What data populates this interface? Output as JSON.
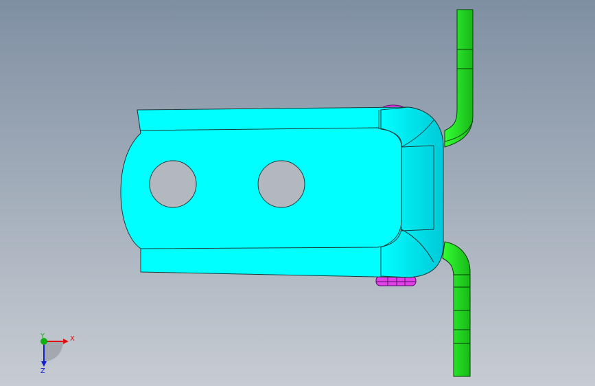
{
  "viewport": {
    "background_top": "#7f8fa3",
    "background_bottom": "#c7ccd2"
  },
  "colors": {
    "bracket_fill": "#00ffff",
    "bracket_shade": "#00c9d8",
    "bracket_edge": "#1a3a3a",
    "hinge_fill": "#33ff33",
    "hinge_shade": "#18b818",
    "pin_fill": "#e040e8",
    "pin_shade": "#9b1fa8",
    "hole_fill": "#b3b8be",
    "axis_x": "#e01010",
    "axis_y": "#10b010",
    "axis_z": "#1020d0"
  },
  "triad": {
    "x_label": "X",
    "y_label": "Y",
    "z_label": "Z"
  }
}
